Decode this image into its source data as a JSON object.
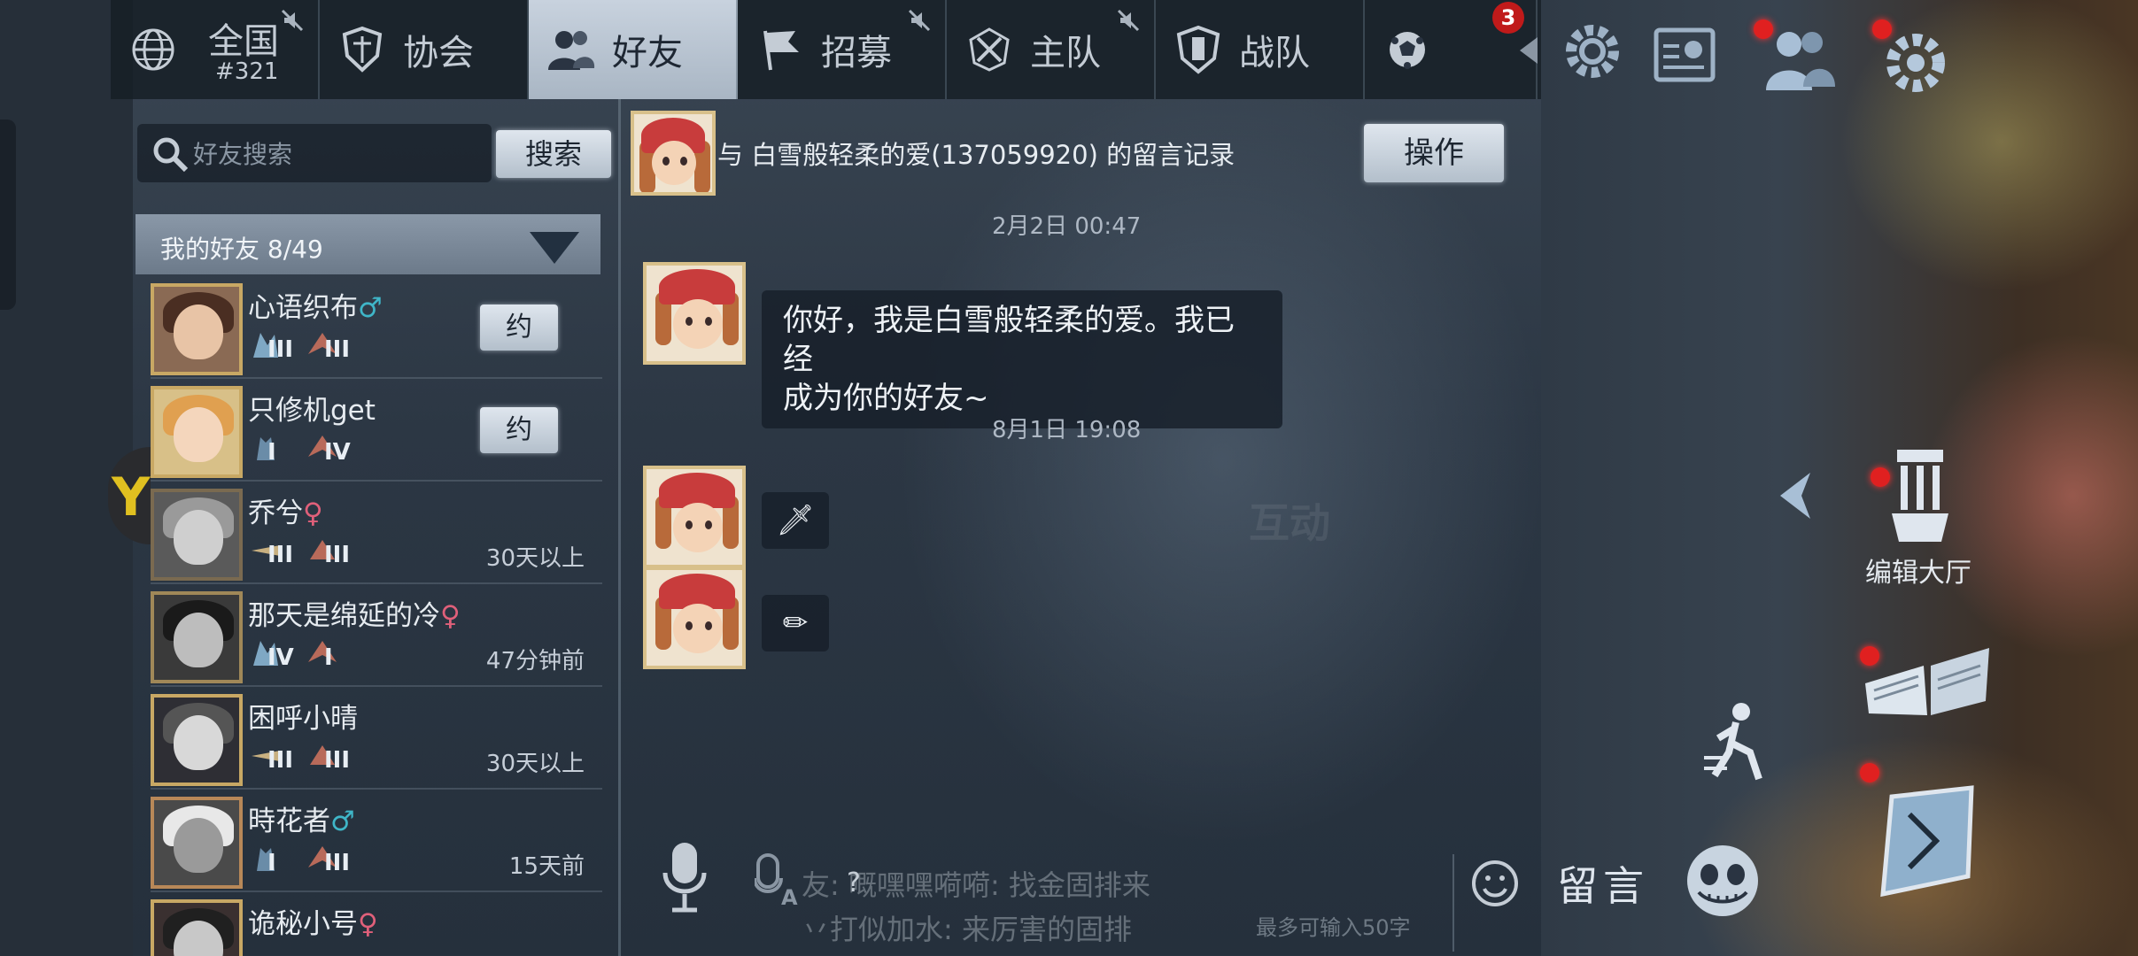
{
  "tabs": [
    {
      "label": "全国",
      "sub": "#321",
      "icon": "globe-icon",
      "muted": true,
      "active": false
    },
    {
      "label": "协会",
      "icon": "shield-icon",
      "muted": false,
      "active": false
    },
    {
      "label": "好友",
      "icon": "friends-icon",
      "muted": false,
      "active": true
    },
    {
      "label": "招募",
      "icon": "flag-icon",
      "muted": true,
      "active": false
    },
    {
      "label": "主队",
      "icon": "team-emblem-icon",
      "muted": true,
      "active": false
    },
    {
      "label": "战队",
      "icon": "clan-shield-icon",
      "muted": false,
      "active": false,
      "badge": "3"
    },
    {
      "label": "",
      "icon": "soccer-ball-icon",
      "muted": false,
      "active": false
    }
  ],
  "search": {
    "placeholder": "好友搜索",
    "button": "搜索"
  },
  "friends_header": {
    "label": "我的好友 8/49"
  },
  "friends": [
    {
      "name": "心语织布",
      "gender": "♂",
      "gender_type": "male",
      "roles": [
        {
          "icon": "survivor-icon",
          "rank": "III"
        },
        {
          "icon": "hunter-icon",
          "rank": "III"
        }
      ],
      "invite": "约",
      "status": ""
    },
    {
      "name": "只修机get",
      "gender": "",
      "gender_type": "",
      "roles": [
        {
          "icon": "survivor-icon",
          "rank": "I"
        },
        {
          "icon": "hunter-icon",
          "rank": "IV"
        }
      ],
      "invite": "约",
      "status": ""
    },
    {
      "name": "乔兮",
      "gender": "♀",
      "gender_type": "female",
      "roles": [
        {
          "icon": "survivor-icon",
          "rank": "III"
        },
        {
          "icon": "hunter-icon",
          "rank": "III"
        }
      ],
      "invite": "",
      "status": "30天以上"
    },
    {
      "name": "那天是绵延的冷",
      "gender": "♀",
      "gender_type": "female",
      "roles": [
        {
          "icon": "survivor-icon",
          "rank": "IV"
        },
        {
          "icon": "hunter-icon",
          "rank": "I"
        }
      ],
      "invite": "",
      "status": "47分钟前"
    },
    {
      "name": "困呼小晴",
      "gender": "",
      "gender_type": "",
      "roles": [
        {
          "icon": "survivor-icon",
          "rank": "III"
        },
        {
          "icon": "hunter-icon",
          "rank": "III"
        }
      ],
      "invite": "",
      "status": "30天以上"
    },
    {
      "name": "時花者",
      "gender": "♂",
      "gender_type": "male",
      "roles": [
        {
          "icon": "survivor-icon",
          "rank": "I"
        },
        {
          "icon": "hunter-icon",
          "rank": "III"
        }
      ],
      "invite": "",
      "status": "15天前"
    },
    {
      "name": "诡秘小号",
      "gender": "♀",
      "gender_type": "female",
      "roles": [],
      "invite": "",
      "status": ""
    }
  ],
  "chat": {
    "title": "与  白雪般轻柔的爱(137059920) 的留言记录",
    "operate_button": "操作",
    "messages": [
      {
        "timestamp": "2月2日 00:47",
        "text": "你好，我是白雪般轻柔的爱。我已经\n成为你的好友~"
      },
      {
        "timestamp": "8月1日 19:08",
        "text": "🗡"
      },
      {
        "timestamp": "",
        "text": "✏"
      }
    ],
    "watermark": "互动",
    "ghost_lines": [
      "友:  嘅嘿嘿嗬嗬: 找金固排来",
      "丷打似加水: 来厉害的固排"
    ],
    "help": "?",
    "input_hint": "最多可输入50字",
    "message_label": "留言"
  },
  "hud": {
    "edit_hall_label": "编辑大厅"
  },
  "colors": {
    "accent_red": "#c01a1a",
    "active_tab": "#c8d2de",
    "male": "#3fb6c8",
    "female": "#e0607a"
  }
}
